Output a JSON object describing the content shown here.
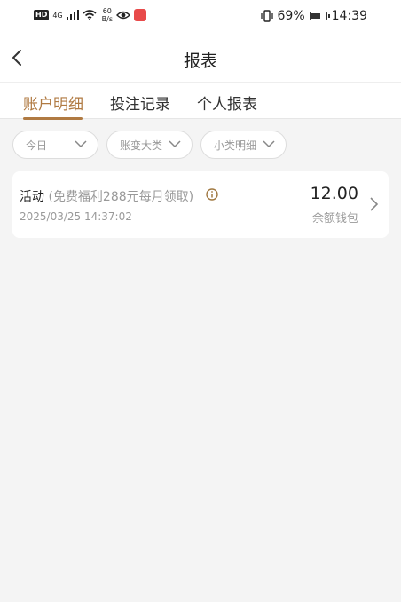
{
  "status_bar": {
    "hd": "HD",
    "signal": "4G",
    "net_speed_value": "60",
    "net_speed_unit": "B/s",
    "battery_percent": "69%",
    "battery_level": 0.69,
    "time": "14:39"
  },
  "header": {
    "title": "报表"
  },
  "tabs": [
    {
      "label": "账户明细",
      "active": true
    },
    {
      "label": "投注记录",
      "active": false
    },
    {
      "label": "个人报表",
      "active": false
    }
  ],
  "filters": [
    {
      "label": "今日"
    },
    {
      "label": "账变大类"
    },
    {
      "label": "小类明细"
    }
  ],
  "records": [
    {
      "title": "活动",
      "title_extra": "(免费福利288元每月领取)",
      "time": "2025/03/25 14:37:02",
      "amount": "12.00",
      "wallet": "余额钱包"
    }
  ],
  "colors": {
    "accent": "#b07a42",
    "background": "#f4f4f4"
  }
}
